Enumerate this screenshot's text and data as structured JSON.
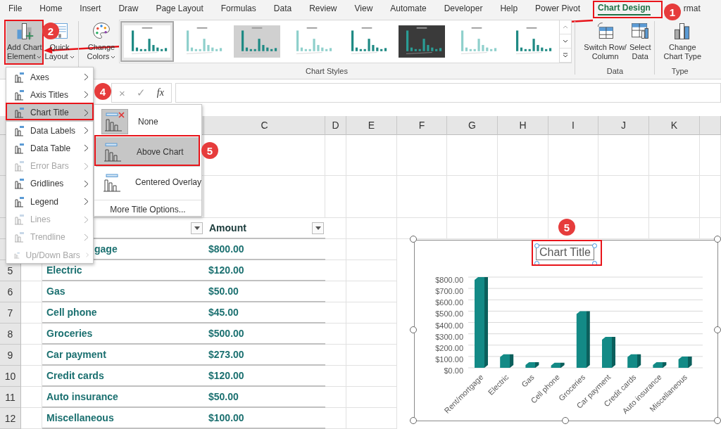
{
  "tabs": [
    {
      "label": "File",
      "selected": false
    },
    {
      "label": "Home",
      "selected": false
    },
    {
      "label": "Insert",
      "selected": false
    },
    {
      "label": "Draw",
      "selected": false
    },
    {
      "label": "Page Layout",
      "selected": false
    },
    {
      "label": "Formulas",
      "selected": false
    },
    {
      "label": "Data",
      "selected": false
    },
    {
      "label": "Review",
      "selected": false
    },
    {
      "label": "View",
      "selected": false
    },
    {
      "label": "Automate",
      "selected": false
    },
    {
      "label": "Developer",
      "selected": false
    },
    {
      "label": "Help",
      "selected": false
    },
    {
      "label": "Power Pivot",
      "selected": false
    },
    {
      "label": "Chart Design",
      "selected": true
    },
    {
      "label": "rmat",
      "selected": false
    }
  ],
  "ribbon": {
    "layout_buttons": [
      {
        "kind": "add-element",
        "lines": [
          "Add Chart",
          "Element"
        ],
        "dropdown": true,
        "selected": true
      },
      {
        "kind": "quick-layout",
        "lines": [
          "Quick",
          "Layout"
        ],
        "dropdown": true,
        "selected": false
      }
    ],
    "colors_button": {
      "kind": "colors",
      "lines": [
        "Change",
        "Colors"
      ],
      "dropdown": true,
      "selected": false
    },
    "chart_styles": {
      "label": "Chart Styles",
      "thumbnails": [
        {
          "kind": "plain",
          "selected": true
        },
        {
          "kind": "light",
          "selected": false
        },
        {
          "kind": "shaded",
          "selected": false
        },
        {
          "kind": "light",
          "selected": false
        },
        {
          "kind": "plain",
          "selected": false
        },
        {
          "kind": "dark",
          "selected": false
        },
        {
          "kind": "light",
          "selected": false
        },
        {
          "kind": "plain",
          "selected": false
        }
      ]
    },
    "data_group": {
      "label": "Data",
      "buttons": [
        {
          "kind": "switch",
          "lines": [
            "Switch Row/",
            "Column"
          ],
          "dropdown": false,
          "selected": false
        },
        {
          "kind": "select",
          "lines": [
            "Select",
            "Data"
          ],
          "dropdown": false,
          "selected": false
        }
      ]
    },
    "type_group": {
      "label": "Type",
      "buttons": [
        {
          "kind": "type",
          "lines": [
            "Change",
            "Chart Type"
          ],
          "dropdown": false,
          "selected": false
        }
      ]
    }
  },
  "formula_bar": {
    "cancel": "×",
    "enter": "✓",
    "function": "fx"
  },
  "columns": [
    "C",
    "D",
    "E",
    "F",
    "G",
    "H",
    "I",
    "J",
    "K"
  ],
  "table": {
    "header": "Amount",
    "rows": [
      {
        "item": "gage",
        "amount": "$800.00"
      },
      {
        "row": "5",
        "item": "Electric",
        "amount": "$120.00"
      },
      {
        "row": "6",
        "item": "Gas",
        "amount": "$50.00"
      },
      {
        "row": "7",
        "item": "Cell phone",
        "amount": "$45.00"
      },
      {
        "row": "8",
        "item": "Groceries",
        "amount": "$500.00"
      },
      {
        "row": "9",
        "item": "Car payment",
        "amount": "$273.00"
      },
      {
        "row": "10",
        "item": "Credit cards",
        "amount": "$120.00"
      },
      {
        "row": "11",
        "item": "Auto insurance",
        "amount": "$50.00"
      },
      {
        "row": "12",
        "item": "Miscellaneous",
        "amount": "$100.00"
      }
    ]
  },
  "menu": {
    "items": [
      {
        "label": "Axes",
        "disabled": false,
        "selected": false
      },
      {
        "label": "Axis Titles",
        "disabled": false,
        "selected": false
      },
      {
        "label": "Chart Title",
        "disabled": false,
        "selected": true
      },
      {
        "label": "Data Labels",
        "disabled": false,
        "selected": false
      },
      {
        "label": "Data Table",
        "disabled": false,
        "selected": false
      },
      {
        "label": "Error Bars",
        "disabled": true,
        "selected": false
      },
      {
        "label": "Gridlines",
        "disabled": false,
        "selected": false
      },
      {
        "label": "Legend",
        "disabled": false,
        "selected": false
      },
      {
        "label": "Lines",
        "disabled": true,
        "selected": false
      },
      {
        "label": "Trendline",
        "disabled": true,
        "selected": false
      },
      {
        "label": "Up/Down Bars",
        "disabled": true,
        "selected": false
      }
    ]
  },
  "submenu": {
    "items": [
      {
        "label": "None",
        "kind": "none",
        "current": true,
        "selected": false
      },
      {
        "label": "Above Chart",
        "kind": "above",
        "current": false,
        "selected": true
      },
      {
        "label": "Centered Overlay",
        "kind": "overlay",
        "current": false,
        "selected": false
      }
    ],
    "more": "More Title Options..."
  },
  "chart": {
    "title": "Chart Title",
    "title_selected": true,
    "chart_data": {
      "type": "bar",
      "categories": [
        "Rent/mortgage",
        "Electric",
        "Gas",
        "Cell phone",
        "Groceries",
        "Car payment",
        "Credit cards",
        "Auto insurance",
        "Miscellaneous"
      ],
      "series": [
        {
          "color": "#138a86",
          "values": [
            800,
            120,
            50,
            45,
            500,
            273,
            120,
            50,
            100
          ]
        }
      ],
      "ylim": [
        0,
        800
      ],
      "grid": true,
      "yticks": [
        {
          "value": 0,
          "label": "$0.00"
        },
        {
          "value": 100,
          "label": "$100.00"
        },
        {
          "value": 200,
          "label": "$200.00"
        },
        {
          "value": 300,
          "label": "$300.00"
        },
        {
          "value": 400,
          "label": "$400.00"
        },
        {
          "value": 500,
          "label": "$500.00"
        },
        {
          "value": 600,
          "label": "$600.00"
        },
        {
          "value": 700,
          "label": "$700.00"
        },
        {
          "value": 800,
          "label": "$800.00"
        }
      ]
    }
  },
  "badges": [
    "1",
    "2",
    "4",
    "5",
    "5"
  ]
}
